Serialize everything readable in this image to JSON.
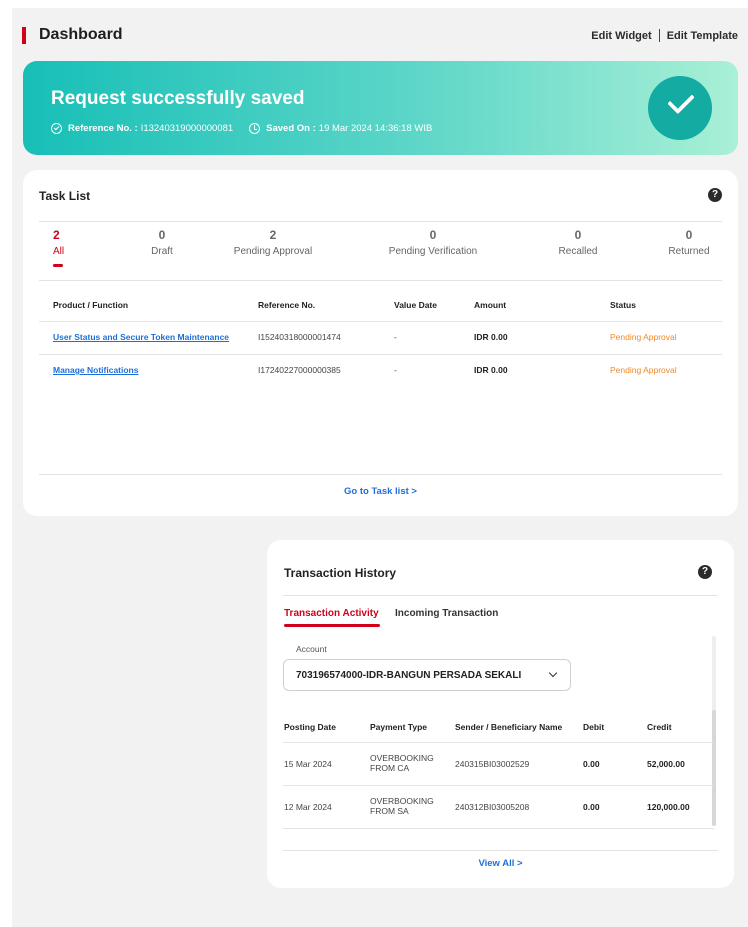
{
  "header": {
    "title": "Dashboard",
    "edit_widget": "Edit Widget",
    "edit_template": "Edit Template"
  },
  "banner": {
    "message": "Request successfully saved",
    "reference_label": "Reference No. :",
    "reference_value": "I13240319000000081",
    "saved_label": "Saved On :",
    "saved_value": "19 Mar 2024 14:36:18 WIB"
  },
  "task_list": {
    "title": "Task List",
    "help": "?",
    "stats": [
      {
        "count": "2",
        "label": "All"
      },
      {
        "count": "0",
        "label": "Draft"
      },
      {
        "count": "2",
        "label": "Pending Approval"
      },
      {
        "count": "0",
        "label": "Pending Verification"
      },
      {
        "count": "0",
        "label": "Recalled"
      },
      {
        "count": "0",
        "label": "Returned"
      }
    ],
    "columns": [
      "Product / Function",
      "Reference No.",
      "Value Date",
      "Amount",
      "Status"
    ],
    "rows": [
      {
        "product": "User Status and Secure Token Maintenance",
        "reference": "I15240318000001474",
        "value_date": "-",
        "amount": "IDR 0.00",
        "status": "Pending Approval"
      },
      {
        "product": "Manage Notifications",
        "reference": "I17240227000000385",
        "value_date": "-",
        "amount": "IDR 0.00",
        "status": "Pending Approval"
      }
    ],
    "go_to": "Go to Task list >"
  },
  "transaction_history": {
    "title": "Transaction History",
    "help": "?",
    "tabs": [
      "Transaction Activity",
      "Incoming Transaction"
    ],
    "account_label": "Account",
    "account_value": "703196574000-IDR-BANGUN PERSADA SEKALI",
    "columns": [
      "Posting Date",
      "Payment Type",
      "Sender / Beneficiary Name",
      "Debit",
      "Credit"
    ],
    "rows": [
      {
        "date": "15 Mar 2024",
        "type_line1": "OVERBOOKING",
        "type_line2": "FROM CA",
        "name": "240315BI03002529",
        "debit": "0.00",
        "credit": "52,000.00"
      },
      {
        "date": "12 Mar 2024",
        "type_line1": "OVERBOOKING",
        "type_line2": "FROM SA",
        "name": "240312BI03005208",
        "debit": "0.00",
        "credit": "120,000.00"
      }
    ],
    "view_all": "View All >"
  },
  "colors": {
    "accent": "#d0021b",
    "link": "#1d6fd8",
    "pending": "#f08a24",
    "banner_start": "#17bfb7",
    "banner_end": "#a9f0d6"
  }
}
